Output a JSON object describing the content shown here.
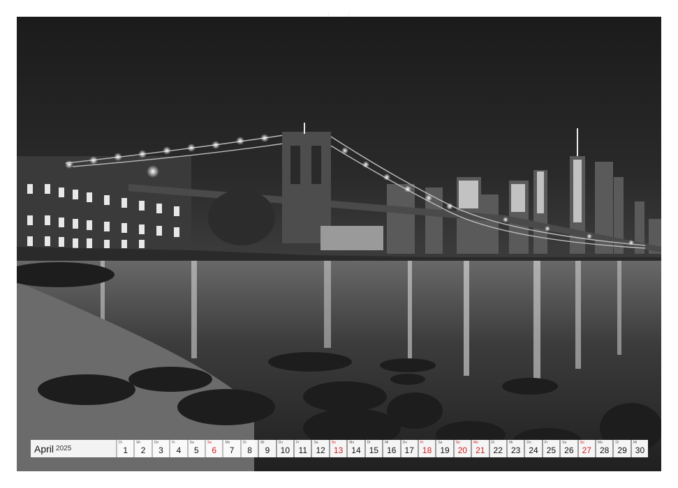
{
  "calendar": {
    "month": "April",
    "year": "2025",
    "days": [
      {
        "wd": "Di",
        "num": "1",
        "red": false
      },
      {
        "wd": "Mi",
        "num": "2",
        "red": false
      },
      {
        "wd": "Do",
        "num": "3",
        "red": false
      },
      {
        "wd": "Fr",
        "num": "4",
        "red": false
      },
      {
        "wd": "Sa",
        "num": "5",
        "red": false
      },
      {
        "wd": "So",
        "num": "6",
        "red": true
      },
      {
        "wd": "Mo",
        "num": "7",
        "red": false
      },
      {
        "wd": "Di",
        "num": "8",
        "red": false
      },
      {
        "wd": "Mi",
        "num": "9",
        "red": false
      },
      {
        "wd": "Do",
        "num": "10",
        "red": false
      },
      {
        "wd": "Fr",
        "num": "11",
        "red": false
      },
      {
        "wd": "Sa",
        "num": "12",
        "red": false
      },
      {
        "wd": "So",
        "num": "13",
        "red": true
      },
      {
        "wd": "Mo",
        "num": "14",
        "red": false
      },
      {
        "wd": "Di",
        "num": "15",
        "red": false
      },
      {
        "wd": "Mi",
        "num": "16",
        "red": false
      },
      {
        "wd": "Do",
        "num": "17",
        "red": false
      },
      {
        "wd": "Fr",
        "num": "18",
        "red": true
      },
      {
        "wd": "Sa",
        "num": "19",
        "red": false
      },
      {
        "wd": "So",
        "num": "20",
        "red": true
      },
      {
        "wd": "Mo",
        "num": "21",
        "red": true
      },
      {
        "wd": "Di",
        "num": "22",
        "red": false
      },
      {
        "wd": "Mi",
        "num": "23",
        "red": false
      },
      {
        "wd": "Do",
        "num": "24",
        "red": false
      },
      {
        "wd": "Fr",
        "num": "25",
        "red": false
      },
      {
        "wd": "Sa",
        "num": "26",
        "red": false
      },
      {
        "wd": "So",
        "num": "27",
        "red": true
      },
      {
        "wd": "Mo",
        "num": "28",
        "red": false
      },
      {
        "wd": "Di",
        "num": "29",
        "red": false
      },
      {
        "wd": "Mi",
        "num": "30",
        "red": false
      }
    ]
  },
  "colors": {
    "holiday_red": "#d21f1f",
    "photo_tone": "monochrome"
  },
  "photo": {
    "subject": "brooklyn-bridge-night-photo"
  }
}
